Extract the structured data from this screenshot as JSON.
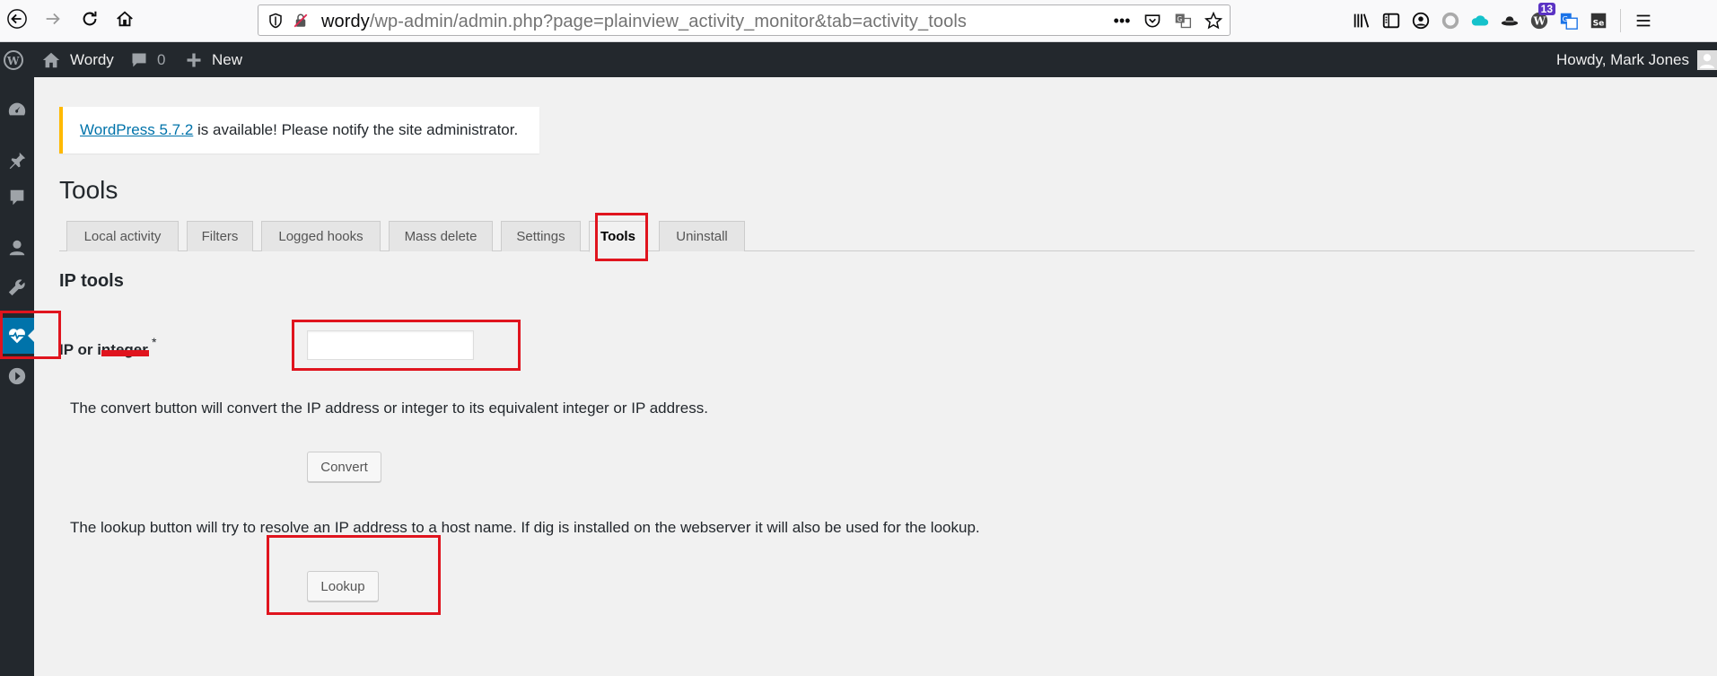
{
  "browser": {
    "url_host": "wordy",
    "url_path": "/wp-admin/admin.php?page=plainview_activity_monitor&tab=activity_tools",
    "more_label": "•••",
    "ext_badge": "13"
  },
  "adminbar": {
    "site_name": "Wordy",
    "comments_count": "0",
    "new_label": "New",
    "howdy": "Howdy, Mark Jones"
  },
  "notice": {
    "link_text": "WordPress 5.7.2",
    "text": " is available! Please notify the site administrator."
  },
  "page": {
    "title": "Tools"
  },
  "tabs": [
    {
      "label": "Local activity"
    },
    {
      "label": "Filters"
    },
    {
      "label": "Logged hooks"
    },
    {
      "label": "Mass delete"
    },
    {
      "label": "Settings"
    },
    {
      "label": "Tools"
    },
    {
      "label": "Uninstall"
    }
  ],
  "ip_tools": {
    "heading": "IP tools",
    "field_label": "IP or integer",
    "required_mark": "*",
    "input_value": "",
    "convert_desc": "The convert button will convert the IP address or integer to its equivalent integer or IP address.",
    "convert_label": "Convert",
    "lookup_desc": "The lookup button will try to resolve an IP address to a host name. If dig is installed on the webserver it will also be used for the lookup.",
    "lookup_label": "Lookup"
  },
  "colors": {
    "adminbar_bg": "#23282d",
    "accent": "#0073aa",
    "notice_border": "#ffb900",
    "annotation_red": "#e0141e"
  }
}
